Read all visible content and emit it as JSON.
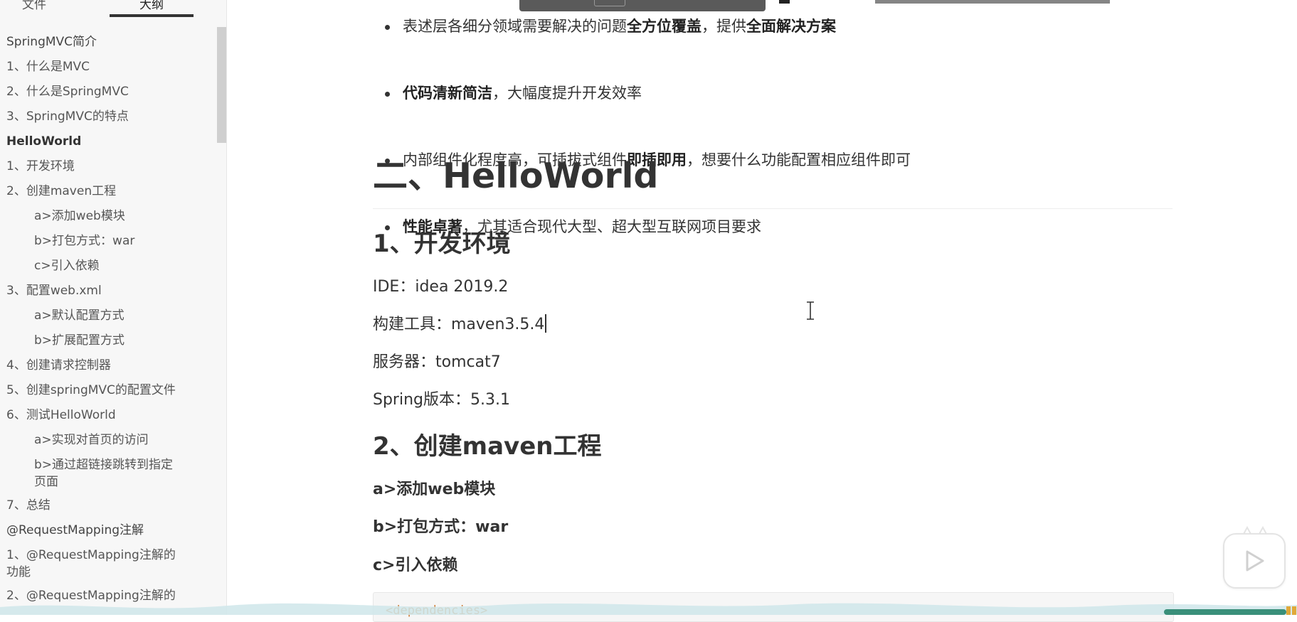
{
  "sidebar": {
    "tabs": {
      "files": "文件",
      "outline": "大纲"
    },
    "items": [
      {
        "label": "SpringMVC简介",
        "level": 1
      },
      {
        "label": "1、什么是MVC",
        "level": 2
      },
      {
        "label": "2、什么是SpringMVC",
        "level": 2
      },
      {
        "label": "3、SpringMVC的特点",
        "level": 2
      },
      {
        "label": "HelloWorld",
        "level": 1
      },
      {
        "label": "1、开发环境",
        "level": 2
      },
      {
        "label": "2、创建maven工程",
        "level": 2
      },
      {
        "label": "a>添加web模块",
        "level": 3
      },
      {
        "label": "b>打包方式：war",
        "level": 3
      },
      {
        "label": "c>引入依赖",
        "level": 3
      },
      {
        "label": "3、配置web.xml",
        "level": 2
      },
      {
        "label": "a>默认配置方式",
        "level": 3
      },
      {
        "label": "b>扩展配置方式",
        "level": 3
      },
      {
        "label": "4、创建请求控制器",
        "level": 2
      },
      {
        "label": "5、创建springMVC的配置文件",
        "level": 2
      },
      {
        "label": "6、测试HelloWorld",
        "level": 2
      },
      {
        "label": "a>实现对首页的访问",
        "level": 3
      },
      {
        "label_line1": "b>通过超链接跳转到指定",
        "label_line2": "页面",
        "level": 3
      },
      {
        "label": "7、总结",
        "level": 2
      },
      {
        "label": "@RequestMapping注解",
        "level": 1
      },
      {
        "label_line1": "1、@RequestMapping注解的",
        "label_line2": "功能",
        "level": 2
      },
      {
        "label": "2、@RequestMapping注解的",
        "level": 2
      }
    ]
  },
  "content": {
    "bullets": [
      {
        "pre": "表述层各细分领域需要解决的问题",
        "bold1": "全方位覆盖",
        "mid": "，提供",
        "bold2": "全面解决方案"
      },
      {
        "bold": "代码清新简洁",
        "post": "，大幅度提升开发效率"
      },
      {
        "pre": "内部组件化程度高，可插拔式组件",
        "bold": "即插即用",
        "post": "，想要什么功能配置相应组件即可"
      },
      {
        "bold": "性能卓著",
        "post": "，尤其适合现代大型、超大型互联网项目要求"
      }
    ],
    "section_title": "二、HelloWorld",
    "sub1_title": "1、开发环境",
    "env": {
      "ide": "IDE：idea 2019.2",
      "build": "构建工具：maven3.5.4",
      "server": "服务器：tomcat7",
      "spring": "Spring版本：5.3.1"
    },
    "sub2_title": "2、创建maven工程",
    "steps": {
      "a": "a>添加web模块",
      "b": "b>打包方式：war",
      "c": "c>引入依赖"
    },
    "code_first_line": "<dependencies>"
  },
  "icons": {
    "cursor": "text-cursor-icon",
    "play": "play-icon"
  },
  "colors": {
    "sidebar_bg": "#f7f7f7",
    "text": "#333333",
    "code_tag": "#cc7a33",
    "wave": "#cfe6ea"
  }
}
